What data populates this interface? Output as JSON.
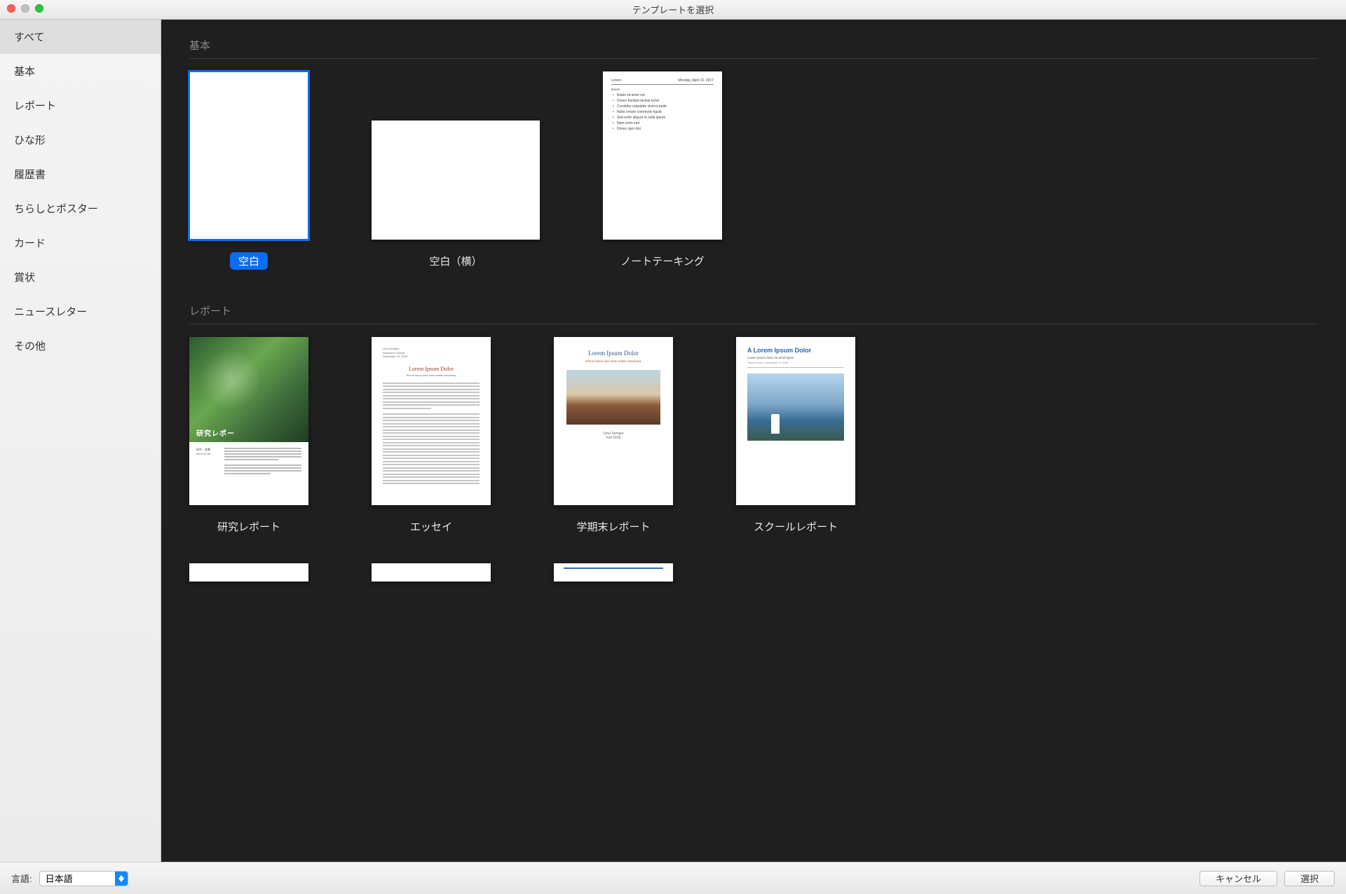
{
  "window": {
    "title": "テンプレートを選択"
  },
  "sidebar": {
    "items": [
      {
        "label": "すべて",
        "selected": true
      },
      {
        "label": "基本"
      },
      {
        "label": "レポート"
      },
      {
        "label": "ひな形"
      },
      {
        "label": "履歴書"
      },
      {
        "label": "ちらしとポスター"
      },
      {
        "label": "カード"
      },
      {
        "label": "賞状"
      },
      {
        "label": "ニュースレター"
      },
      {
        "label": "その他"
      }
    ]
  },
  "sections": {
    "basic": {
      "title": "基本",
      "templates": [
        {
          "label": "空白",
          "selected": true,
          "orientation": "portrait",
          "kind": "blank"
        },
        {
          "label": "空白（横）",
          "orientation": "landscape",
          "kind": "blank"
        },
        {
          "label": "ノートテーキング",
          "orientation": "portrait",
          "kind": "notetaking",
          "preview": {
            "heading": "Lorem",
            "date": "Monday, April 10, 2017",
            "bullets": [
              "Etiam sit amet est",
              "Donec facilisis lacinia tortor",
              "Curabitur vulputate viverra pede",
              "Nulla ornare commodo ligula",
              "Sed enim aliquet in nulla ipsum",
              "Nam enim sed",
              "Donec quis nisi"
            ]
          }
        }
      ]
    },
    "report": {
      "title": "レポート",
      "templates": [
        {
          "label": "研究レポート",
          "orientation": "portrait",
          "kind": "research",
          "preview": {
            "caption": "研究レポー"
          }
        },
        {
          "label": "エッセイ",
          "orientation": "portrait",
          "kind": "essay",
          "preview": {
            "meta1": "Urna Semper",
            "meta2": "Instructor's Name",
            "meta3": "December 13, 2018",
            "title": "Lorem Ipsum Dolor",
            "subtitle": "Sed et lacus quis enim mattis nonummy"
          }
        },
        {
          "label": "学期末レポート",
          "orientation": "portrait",
          "kind": "termpaper",
          "preview": {
            "title": "Lorem Ipsum Dolor",
            "subtitle": "Sed et lacus quis enim mattis nonummy",
            "author": "Urna Semper",
            "term": "Fall 2018"
          }
        },
        {
          "label": "スクールレポート",
          "orientation": "portrait",
          "kind": "schoolreport",
          "preview": {
            "title": "A Lorem Ipsum Dolor",
            "subtitle": "Lorem ipsum dolor sit amet ligula",
            "meta": "Trenz Pruca • December 6, 2018"
          }
        }
      ]
    }
  },
  "footer": {
    "language_label": "言語:",
    "language_value": "日本語",
    "cancel": "キャンセル",
    "choose": "選択"
  }
}
